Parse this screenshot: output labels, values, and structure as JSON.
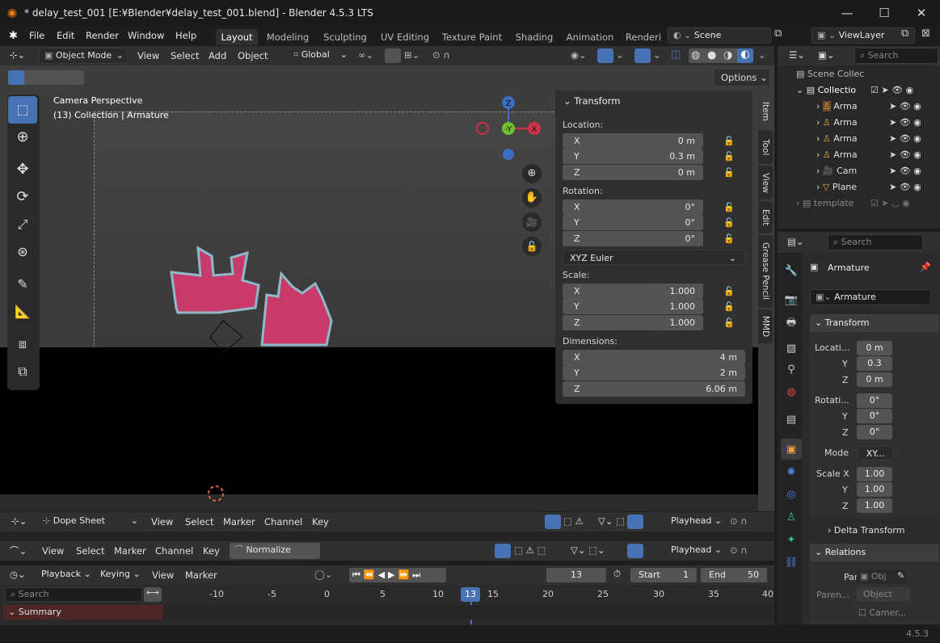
{
  "window": {
    "title": "* delay_test_001 [E:¥Blender¥delay_test_001.blend] - Blender 4.5.3 LTS",
    "minimize": "—",
    "maximize": "☐",
    "close": "✕"
  },
  "menu": {
    "items": [
      "File",
      "Edit",
      "Render",
      "Window",
      "Help"
    ]
  },
  "workspaces": [
    "Layout",
    "Modeling",
    "Sculpting",
    "UV Editing",
    "Texture Paint",
    "Shading",
    "Animation",
    "Renderi"
  ],
  "scene": {
    "name": "Scene",
    "view_layer": "ViewLayer"
  },
  "viewport_header": {
    "mode": "Object Mode",
    "menus": [
      "View",
      "Select",
      "Add",
      "Object"
    ],
    "orientation": "Global",
    "options": "Options"
  },
  "viewport": {
    "camera_label": "Camera Perspective",
    "collection_label": "(13) Collection | Armature"
  },
  "gizmo": {
    "z": "Z",
    "y": "-Y",
    "x": "X"
  },
  "npanel": {
    "title": "Transform",
    "location_label": "Location:",
    "loc": [
      "0 m",
      "0.3 m",
      "0 m"
    ],
    "rotation_label": "Rotation:",
    "rot": [
      "0°",
      "0°",
      "0°"
    ],
    "rotation_mode": "XYZ Euler",
    "scale_label": "Scale:",
    "scale": [
      "1.000",
      "1.000",
      "1.000"
    ],
    "dimensions_label": "Dimensions:",
    "dim": [
      "4 m",
      "2 m",
      "6.06 m"
    ],
    "axes": [
      "X",
      "Y",
      "Z"
    ]
  },
  "side_tabs": [
    "Item",
    "Tool",
    "View",
    "Edit",
    "Grease Pencil",
    "MMD"
  ],
  "outliner": {
    "search": "Search",
    "root": "Scene Collec",
    "collection": "Collectio",
    "items": [
      "Arma",
      "Arma",
      "Arma",
      "Arma",
      "Cam",
      "Plane"
    ],
    "template": "template"
  },
  "properties": {
    "search": "Search",
    "object_name": "Armature",
    "data_name": "Armature",
    "transform": "Transform",
    "location": "Locati...",
    "loc": [
      "0 m",
      "0.3",
      "0 m"
    ],
    "rotation": "Rotati...",
    "rot": [
      "0°",
      "0°",
      "0°"
    ],
    "mode_label": "Mode",
    "mode_value": "XY...",
    "scale_label": "Scale X",
    "scale": [
      "1.00",
      "1.00",
      "1.00"
    ],
    "axis_y": "Y",
    "axis_z": "Z",
    "delta": "Delta Transform",
    "relations": "Relations",
    "parent_label": "Parent",
    "parent_value": "Obj",
    "parent_type_label": "Paren...",
    "parent_type": "Object",
    "camera": "Camer..."
  },
  "dopesheet": {
    "editor": "Dope Sheet",
    "menus": [
      "View",
      "Select",
      "Marker",
      "Channel",
      "Key"
    ],
    "playhead": "Playhead"
  },
  "graph": {
    "menus": [
      "View",
      "Select",
      "Marker",
      "Channel",
      "Key"
    ],
    "normalize": "Normalize",
    "playhead": "Playhead"
  },
  "timeline": {
    "playback": "Playback",
    "keying": "Keying",
    "view": "View",
    "marker": "Marker",
    "current_frame": "13",
    "start_label": "Start",
    "start": "1",
    "end_label": "End",
    "end": "50",
    "search": "Search",
    "summary": "Summary",
    "ruler": [
      "-10",
      "-5",
      "0",
      "5",
      "10",
      "13",
      "15",
      "20",
      "25",
      "30",
      "35",
      "40"
    ]
  },
  "status": {
    "version": "4.5.3"
  },
  "colors": {
    "accent": "#4772b3",
    "header": "#303030",
    "summary": "#4f2626"
  }
}
